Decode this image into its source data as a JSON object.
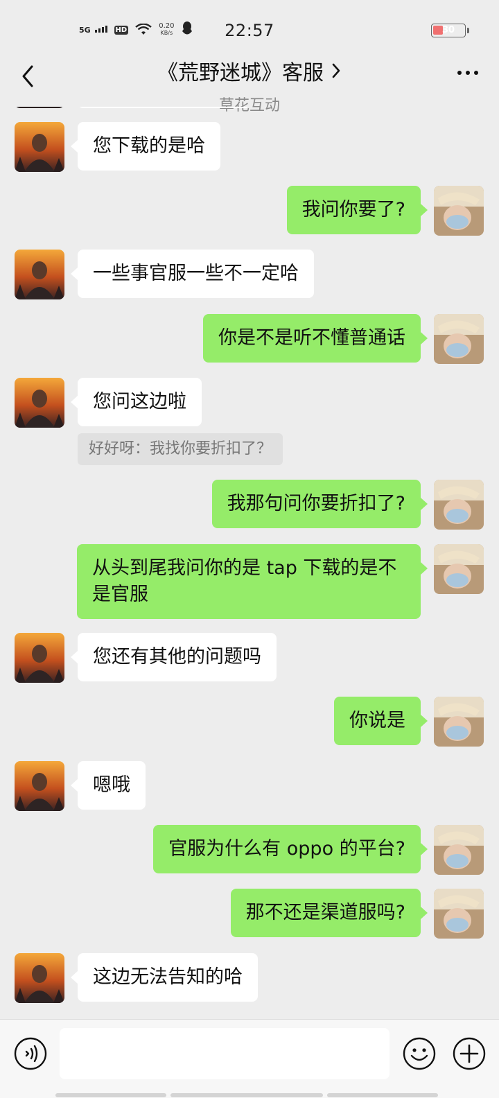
{
  "status_bar": {
    "network": "5G",
    "hd": "HD",
    "speed_value": "0.20",
    "speed_unit": "KB/s",
    "time": "22:57",
    "battery": "30"
  },
  "header": {
    "title": "《荒野迷城》客服",
    "subtitle": "草花互动"
  },
  "messages": [
    {
      "side": "in",
      "text": "您下载的是哈"
    },
    {
      "side": "out",
      "text": "我问你要了?"
    },
    {
      "side": "in",
      "text": "一些事官服一些不一定哈"
    },
    {
      "side": "out",
      "text": "你是不是听不懂普通话"
    },
    {
      "side": "in",
      "text": "您问这边啦",
      "quote": "好好呀：我找你要折扣了？"
    },
    {
      "side": "out",
      "text": "我那句问你要折扣了?"
    },
    {
      "side": "out",
      "text": "从头到尾我问你的是 tap 下载的是不是官服"
    },
    {
      "side": "in",
      "text": "您还有其他的问题吗"
    },
    {
      "side": "out",
      "text": "你说是"
    },
    {
      "side": "in",
      "text": "嗯哦"
    },
    {
      "side": "out",
      "text": "官服为什么有 oppo 的平台?"
    },
    {
      "side": "out",
      "text": "那不还是渠道服吗?"
    },
    {
      "side": "in",
      "text": "这边无法告知的哈"
    }
  ],
  "colors": {
    "incoming_bubble": "#ffffff",
    "outgoing_bubble": "#95ec69",
    "background": "#ededed"
  },
  "icons": {
    "back": "chevron-left-icon",
    "more": "more-dots-icon",
    "voice": "voice-icon",
    "emoji": "emoji-icon",
    "plus": "plus-icon"
  }
}
